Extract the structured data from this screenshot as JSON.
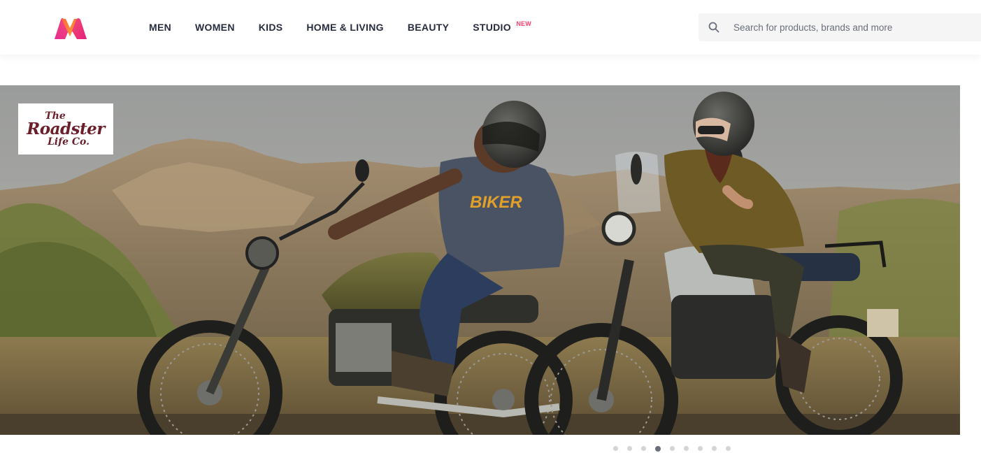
{
  "header": {
    "nav": [
      {
        "label": "MEN"
      },
      {
        "label": "WOMEN"
      },
      {
        "label": "KIDS"
      },
      {
        "label": "HOME & LIVING"
      },
      {
        "label": "BEAUTY"
      },
      {
        "label": "STUDIO",
        "badge": "NEW"
      }
    ],
    "search": {
      "placeholder": "Search for products, brands and more",
      "value": ""
    },
    "icons": {
      "logo": "myntra-logo-icon",
      "search": "search-icon"
    }
  },
  "banner": {
    "brand": {
      "line1": "The",
      "line2": "Roadster",
      "line3": "Life Co."
    },
    "tshirt_print": "BIKER",
    "carousel": {
      "total_slides": 9,
      "active_index": 3
    }
  },
  "colors": {
    "text": "#282c3f",
    "badge": "#ff3f6c",
    "search_bg": "#f5f5f6",
    "brand": "#6a1f2a",
    "dot": "#d4d5d9",
    "dot_active": "#696e79"
  }
}
